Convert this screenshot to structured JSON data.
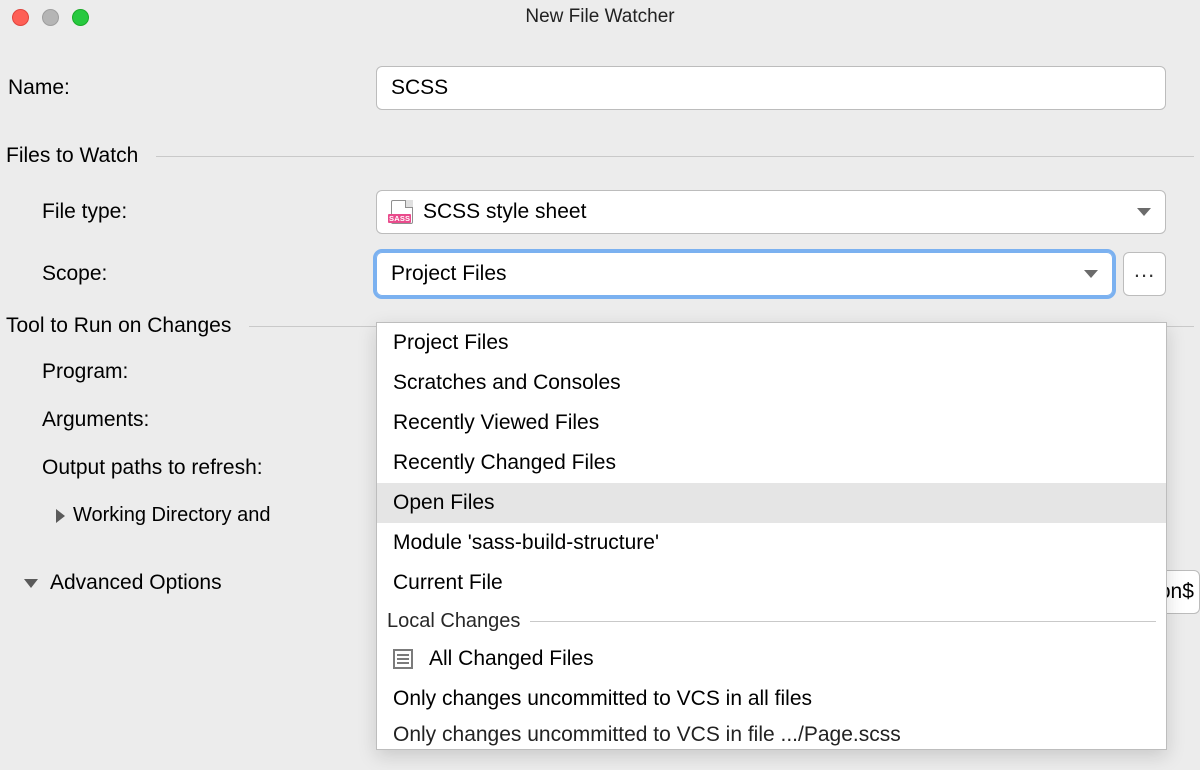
{
  "window": {
    "title": "New File Watcher"
  },
  "fields": {
    "name": {
      "label": "Name:",
      "value": "SCSS"
    },
    "file_type": {
      "label": "File type:",
      "value": "SCSS style sheet"
    },
    "scope": {
      "label": "Scope:",
      "value": "Project Files",
      "browse": "..."
    },
    "program": {
      "label": "Program:"
    },
    "arguments": {
      "label": "Arguments:"
    },
    "output_paths": {
      "label": "Output paths to refresh:",
      "partial_value": "nsion$"
    },
    "working_dir": {
      "label": "Working Directory and"
    }
  },
  "sections": {
    "files_to_watch": "Files to Watch",
    "tool_to_run": "Tool to Run on Changes",
    "advanced": "Advanced Options"
  },
  "dropdown": {
    "items": [
      {
        "label": "Project Files"
      },
      {
        "label": "Scratches and Consoles"
      },
      {
        "label": "Recently Viewed Files"
      },
      {
        "label": "Recently Changed Files"
      },
      {
        "label": "Open Files",
        "highlight": true
      },
      {
        "label": "Module 'sass-build-structure'"
      },
      {
        "label": "Current File"
      }
    ],
    "separator": "Local Changes",
    "items2": [
      {
        "label": "All Changed Files",
        "icon": "changes"
      },
      {
        "label": "Only changes uncommitted to VCS in all files"
      },
      {
        "label": "Only changes uncommitted to VCS in file .../Page.scss"
      }
    ]
  },
  "icons": {
    "sass_tag": "SASS"
  }
}
